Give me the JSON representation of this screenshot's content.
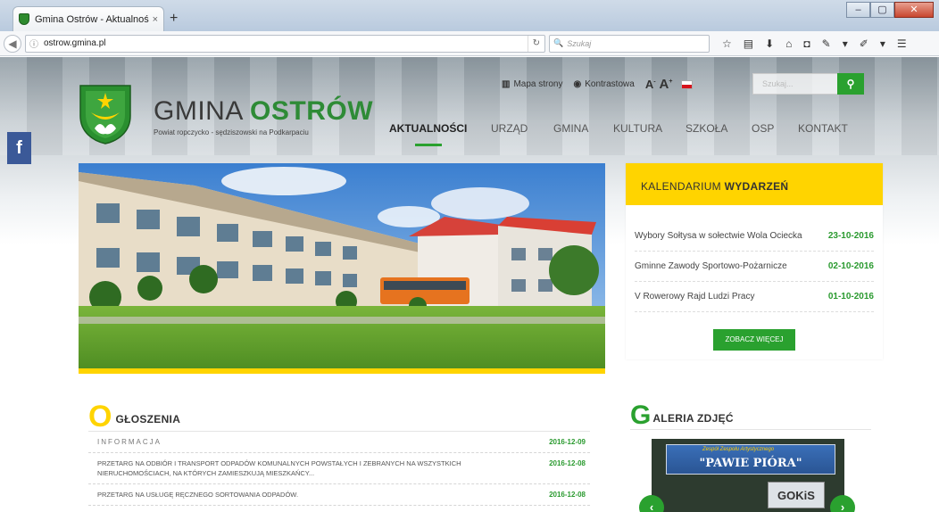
{
  "browser": {
    "tab_title": "Gmina Ostrów - Aktualności",
    "tab_close": "×",
    "new_tab": "+",
    "url": "ostrow.gmina.pl",
    "search_placeholder": "Szukaj",
    "window_controls": [
      "–",
      "▢",
      "✕"
    ]
  },
  "site": {
    "brand_gmina": "GMINA",
    "brand_ostrow": "OSTRÓW",
    "brand_sub": "Powiat ropczycko - sędziszowski na Podkarpaciu",
    "tools": {
      "sitemap": "Mapa strony",
      "contrast": "Kontrastowa",
      "font_small": "A",
      "font_large": "A",
      "search_placeholder": "Szukaj..."
    },
    "nav": [
      "AKTUALNOŚCI",
      "URZĄD",
      "GMINA",
      "KULTURA",
      "SZKOŁA",
      "OSP",
      "KONTAKT"
    ],
    "facebook": "f"
  },
  "calendar": {
    "title_light": "KALENDARIUM ",
    "title_bold": "WYDARZEŃ",
    "events": [
      {
        "name": "Wybory Sołtysa w sołectwie Wola Ociecka",
        "date": "23-10-2016"
      },
      {
        "name": "Gminne Zawody Sportowo-Pożarnicze",
        "date": "02-10-2016"
      },
      {
        "name": "V Rowerowy Rajd Ludzi Pracy",
        "date": "01-10-2016"
      }
    ],
    "more_button": "ZOBACZ WIĘCEJ"
  },
  "announcements": {
    "title_big": "O",
    "title_rest": "GŁOSZENIA",
    "rows": [
      {
        "text": "INFORMACJA",
        "date": "2016-12-09"
      },
      {
        "text": "PRZETARG NA ODBIÓR I TRANSPORT ODPADÓW KOMUNALNYCH POWSTAŁYCH I ZEBRANYCH NA WSZYSTKICH NIERUCHOMOŚCIACH, NA KTÓRYCH ZAMIESZKUJĄ MIESZKAŃCY...",
        "date": "2016-12-08"
      },
      {
        "text": "PRZETARG NA USŁUGĘ RĘCZNEGO SORTOWANIA ODPADÓW.",
        "date": "2016-12-08"
      }
    ]
  },
  "gallery": {
    "title_big": "G",
    "title_rest": "ALERIA ZDJĘĆ",
    "sign_small": "Zespół Zespołu Artystycznego",
    "sign": "\"PAWIE PIÓRA\"",
    "sign2": "GOKiS",
    "prev": "‹",
    "next": "›"
  }
}
